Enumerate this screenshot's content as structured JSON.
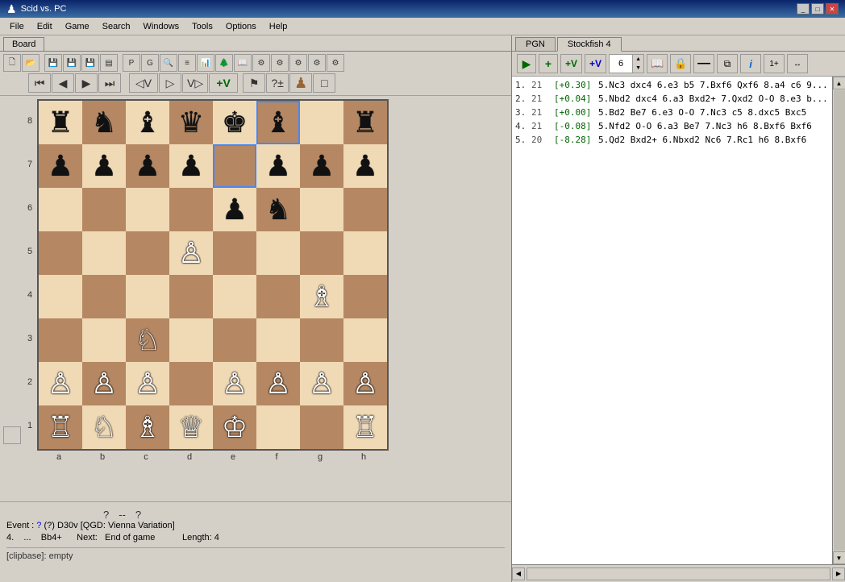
{
  "titlebar": {
    "title": "Scid vs. PC",
    "icon": "♟"
  },
  "menubar": {
    "items": [
      "File",
      "Edit",
      "Game",
      "Search",
      "Windows",
      "Tools",
      "Options",
      "Help"
    ]
  },
  "board": {
    "tab": "Board",
    "squares": [
      [
        "r",
        "n",
        "b",
        "q",
        "k",
        "b",
        ".",
        "r"
      ],
      [
        "p",
        "p",
        "p",
        "p",
        ".",
        "p",
        "p",
        "p"
      ],
      [
        ".",
        ".",
        ".",
        ".",
        "p",
        "n",
        ".",
        "."
      ],
      [
        ".",
        ".",
        ".",
        "P",
        ".",
        ".",
        ".",
        "."
      ],
      [
        ".",
        ".",
        ".",
        ".",
        ".",
        ".",
        "B",
        "."
      ],
      [
        ".",
        ".",
        "N",
        ".",
        ".",
        ".",
        ".",
        "."
      ],
      [
        "P",
        "P",
        "P",
        ".",
        "P",
        "P",
        "P",
        "P"
      ],
      [
        "R",
        "N",
        "B",
        "Q",
        "K",
        ".",
        ".",
        "R"
      ]
    ],
    "ranks": [
      "8",
      "7",
      "6",
      "5",
      "4",
      "3",
      "2",
      "1"
    ],
    "files": [
      "a",
      "b",
      "c",
      "d",
      "e",
      "f",
      "g",
      "h"
    ],
    "highlights": [
      [
        0,
        5
      ],
      [
        1,
        4
      ]
    ]
  },
  "status": {
    "event_label": "Event :",
    "event_value": "?",
    "event_paren_q": "(?)",
    "eco": "D30v [QGD: Vienna Variation]",
    "move_num": "4.",
    "move_dots": "...",
    "move": "Bb4+",
    "next_label": "Next:",
    "next_value": "End of game",
    "length_label": "Length:",
    "length_value": "4",
    "nav_dots": [
      "?",
      "--",
      "?"
    ],
    "clipbase": "[clipbase]:  empty"
  },
  "right": {
    "tabs": [
      "PGN",
      "Stockfish 4"
    ],
    "active_tab": 1,
    "engine_controls": {
      "play": "▶",
      "plus": "+",
      "plus_v": "+V",
      "plus_v2": "+V",
      "depth_value": "6",
      "book_icon": "📖",
      "lock_icon": "🔒",
      "minus_icon": "—",
      "copy_icon": "⧉",
      "info_icon": "ℹ",
      "extra": "1+"
    },
    "analysis_lines": [
      {
        "num": "1.",
        "depth": "21",
        "score": "[+0.30]",
        "moves": "5.Nc3 dxc4 6.e3 b5 7.Bxf6 Qxf6 8.a4 c6 9..."
      },
      {
        "num": "2.",
        "depth": "21",
        "score": "[+0.04]",
        "moves": "5.Nbd2 dxc4 6.a3 Bxd2+ 7.Qxd2 O-O 8.e3 b..."
      },
      {
        "num": "3.",
        "depth": "21",
        "score": "[+0.00]",
        "moves": "5.Bd2 Be7 6.e3 O-O 7.Nc3 c5 8.dxc5 Bxc5"
      },
      {
        "num": "4.",
        "depth": "21",
        "score": "[-0.08]",
        "moves": "5.Nfd2 O-O 6.a3 Be7 7.Nc3 h6 8.Bxf6 Bxf6"
      },
      {
        "num": "5.",
        "depth": "20",
        "score": "[-8.28]",
        "moves": "5.Qd2 Bxd2+ 6.Nbxd2 Nc6 7.Rc1 h6 8.Bxf6"
      }
    ]
  }
}
